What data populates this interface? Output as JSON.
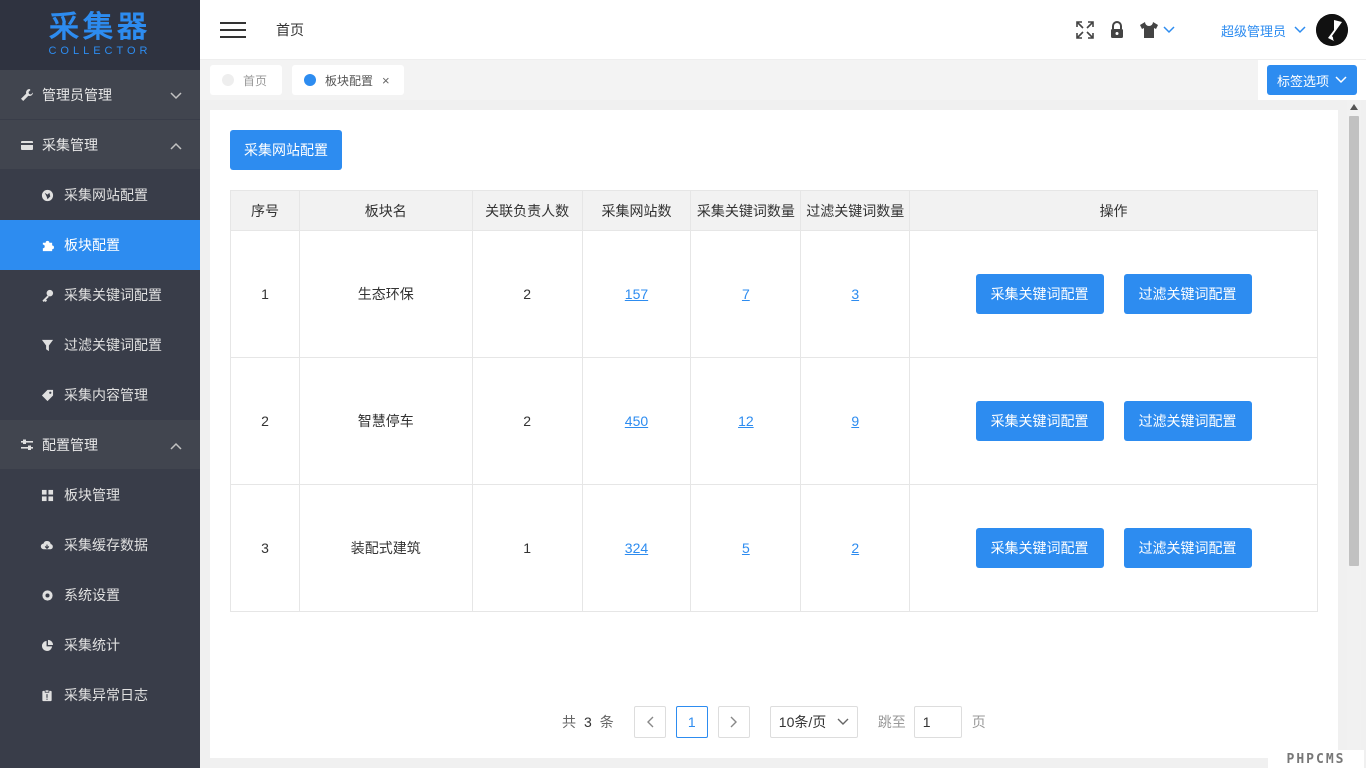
{
  "logo": {
    "main": "采集器",
    "sub": "COLLECTOR"
  },
  "sidebar": {
    "groups": [
      {
        "label": "管理员管理",
        "icon": "wrench-icon",
        "expanded": false,
        "items": []
      },
      {
        "label": "采集管理",
        "icon": "card-icon",
        "expanded": true,
        "items": [
          {
            "label": "采集网站配置",
            "icon": "globe-icon",
            "active": false
          },
          {
            "label": "板块配置",
            "icon": "puzzle-icon",
            "active": true
          },
          {
            "label": "采集关键词配置",
            "icon": "key-icon",
            "active": false
          },
          {
            "label": "过滤关键词配置",
            "icon": "filter-icon",
            "active": false
          },
          {
            "label": "采集内容管理",
            "icon": "tag-icon",
            "active": false
          }
        ]
      },
      {
        "label": "配置管理",
        "icon": "sliders-icon",
        "expanded": true,
        "items": [
          {
            "label": "板块管理",
            "icon": "grid-icon"
          },
          {
            "label": "采集缓存数据",
            "icon": "cloud-icon"
          },
          {
            "label": "系统设置",
            "icon": "gear-icon"
          },
          {
            "label": "采集统计",
            "icon": "pie-icon"
          },
          {
            "label": "采集异常日志",
            "icon": "clipboard-icon"
          }
        ]
      }
    ]
  },
  "header": {
    "title": "首页",
    "user": "超级管理员"
  },
  "tabs": [
    {
      "label": "首页",
      "active": false
    },
    {
      "label": "板块配置",
      "active": true,
      "close": "×"
    }
  ],
  "tab_options_label": "标签选项",
  "main": {
    "top_button": "采集网站配置",
    "table": {
      "headers": [
        "序号",
        "板块名",
        "关联负责人数",
        "采集网站数",
        "采集关键词数量",
        "过滤关键词数量",
        "操作"
      ],
      "rows": [
        {
          "index": "1",
          "name": "生态环保",
          "owners": "2",
          "sites": "157",
          "keywords": "7",
          "filters": "3"
        },
        {
          "index": "2",
          "name": "智慧停车",
          "owners": "2",
          "sites": "450",
          "keywords": "12",
          "filters": "9"
        },
        {
          "index": "3",
          "name": "装配式建筑",
          "owners": "1",
          "sites": "324",
          "keywords": "5",
          "filters": "2"
        }
      ],
      "op_keyword_label": "采集关键词配置",
      "op_filter_label": "过滤关键词配置"
    },
    "pagination": {
      "total_prefix": "共",
      "total": "3",
      "total_suffix": "条",
      "current_page": "1",
      "page_size": "10条/页",
      "jump_label": "跳至",
      "jump_value": "1",
      "jump_suffix": "页"
    }
  },
  "watermark": "PHPCMS",
  "colors": {
    "accent": "#2d8cf0",
    "sidebar_bg": "#393d49"
  }
}
